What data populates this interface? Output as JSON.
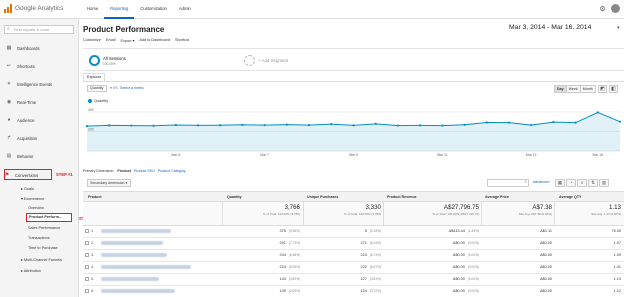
{
  "app": {
    "logo_text": "Google Analytics",
    "nav": [
      "Home",
      "Reporting",
      "Customization",
      "Admin"
    ],
    "active_nav": "Reporting",
    "brand_color": "#058dc7",
    "accent_color": "#e02020"
  },
  "sidebar": {
    "search_placeholder": "Find reports & more",
    "items": [
      {
        "label": "Dashboards",
        "icon": "grid-icon"
      },
      {
        "label": "Shortcuts",
        "icon": "shortcut-icon"
      },
      {
        "label": "Intelligence Events",
        "icon": "lightbulb-icon"
      },
      {
        "label": "Real-Time",
        "icon": "clock-icon"
      },
      {
        "label": "Audience",
        "icon": "person-icon"
      },
      {
        "label": "Acquisition",
        "icon": "acquisition-icon"
      },
      {
        "label": "Behavior",
        "icon": "behavior-icon"
      },
      {
        "label": "Conversions",
        "icon": "flag-icon"
      }
    ],
    "sub": {
      "goals": "▸ Goals",
      "ecommerce": "▾ Ecommerce",
      "overview": "Overview",
      "product_performance": "Product Perform...",
      "sales_performance": "Sales Performance",
      "transactions": "Transactions",
      "time_to_purchase": "Time to Purchase",
      "multi_channel": "▸ Multi-Channel Funnels",
      "attribution": "▸ Attribution"
    },
    "step1": "STEP #1",
    "step2": "STEP #2"
  },
  "header": {
    "title": "Product Performance",
    "date_range": "Mar 3, 2014 - Mar 16, 2014",
    "toolbar": [
      "Customize",
      "Email",
      "Export ▾",
      "Add to Dashboard",
      "Shortcut"
    ]
  },
  "segments": {
    "active_name": "All Sessions",
    "active_pct": "100.00%",
    "add_label": "+ Add Segment"
  },
  "explorer": {
    "tab": "Explorer",
    "metric": "Quantity",
    "vs": "▾ VS",
    "select_metric": "Select a metric",
    "periods": [
      "Day",
      "Week",
      "Month"
    ],
    "active_period": "Day",
    "legend": "Quantity"
  },
  "chart_data": {
    "type": "area",
    "series": [
      {
        "name": "Quantity",
        "values": [
          255,
          262,
          260,
          258,
          266,
          262,
          263,
          268,
          264,
          270,
          265,
          275,
          262,
          278,
          260,
          262,
          260,
          268,
          292,
          290,
          265,
          295,
          290,
          395,
          300
        ]
      }
    ],
    "x_labels": [
      "Mar 5",
      "Mar 7",
      "Mar 9",
      "Mar 11",
      "Mar 13",
      "Mar 15"
    ],
    "y_ticks": [
      400,
      200
    ],
    "ylim": [
      0,
      450
    ],
    "color": "#058dc7"
  },
  "dimension": {
    "label": "Primary Dimension:",
    "current": "Product",
    "options": [
      "Product SKU",
      "Product Category"
    ],
    "secondary": "Secondary dimension ▾",
    "advanced": "advanced"
  },
  "table": {
    "headers": [
      "Product",
      "Quantity",
      "Unique Purchases",
      "Product Revenue",
      "Average Price",
      "Average QTY"
    ],
    "totals": [
      {
        "big": "3,766",
        "small": "% of Total: 100.00% (3,766)"
      },
      {
        "big": "3,330",
        "small": "% of Total: 100.00% (3,330)"
      },
      {
        "big": "A$27,796.75",
        "small": "% of Total: 100.00% (A$27,796.75)"
      },
      {
        "big": "A$7.38",
        "small": "Site Avg: A$7.38 (0.00%)"
      },
      {
        "big": "1.13",
        "small": "Site Avg: 1.13 (0.00%)"
      }
    ],
    "rows": [
      {
        "n": "1.",
        "qty": "375",
        "qty_pct": "(9.96%)",
        "up": "5",
        "up_pct": "(0.15%)",
        "rev": "A$413.44",
        "rev_pct": "(1.49%)",
        "avg": "A$1.11",
        "aq": "75.00"
      },
      {
        "n": "2.",
        "qty": "291",
        "qty_pct": "(7.73%)",
        "up": "271",
        "up_pct": "(8.14%)",
        "rev": "A$0.00",
        "rev_pct": "(0.00%)",
        "avg": "A$0.00",
        "aq": "1.07"
      },
      {
        "n": "3.",
        "qty": "244",
        "qty_pct": "(6.48%)",
        "up": "224",
        "up_pct": "(6.73%)",
        "rev": "A$0.00",
        "rev_pct": "(0.00%)",
        "avg": "A$0.00",
        "aq": "1.09"
      },
      {
        "n": "4.",
        "qty": "224",
        "qty_pct": "(5.95%)",
        "up": "222",
        "up_pct": "(6.67%)",
        "rev": "A$0.00",
        "rev_pct": "(0.00%)",
        "avg": "A$0.00",
        "aq": "1.01"
      },
      {
        "n": "5.",
        "qty": "143",
        "qty_pct": "(3.80%)",
        "up": "127",
        "up_pct": "(3.81%)",
        "rev": "A$0.00",
        "rev_pct": "(0.00%)",
        "avg": "A$0.00",
        "aq": "1.13"
      },
      {
        "n": "6.",
        "qty": "139",
        "qty_pct": "(3.69%)",
        "up": "124",
        "up_pct": "(3.72%)",
        "rev": "A$0.00",
        "rev_pct": "(0.00%)",
        "avg": "A$0.00",
        "aq": "1.12"
      },
      {
        "n": "7.",
        "qty": "111",
        "qty_pct": "(2.95%)",
        "up": "108",
        "up_pct": "(3.24%)",
        "rev": "A$0.00",
        "rev_pct": "(0.00%)",
        "avg": "A$0.00",
        "aq": "1.03"
      }
    ]
  }
}
